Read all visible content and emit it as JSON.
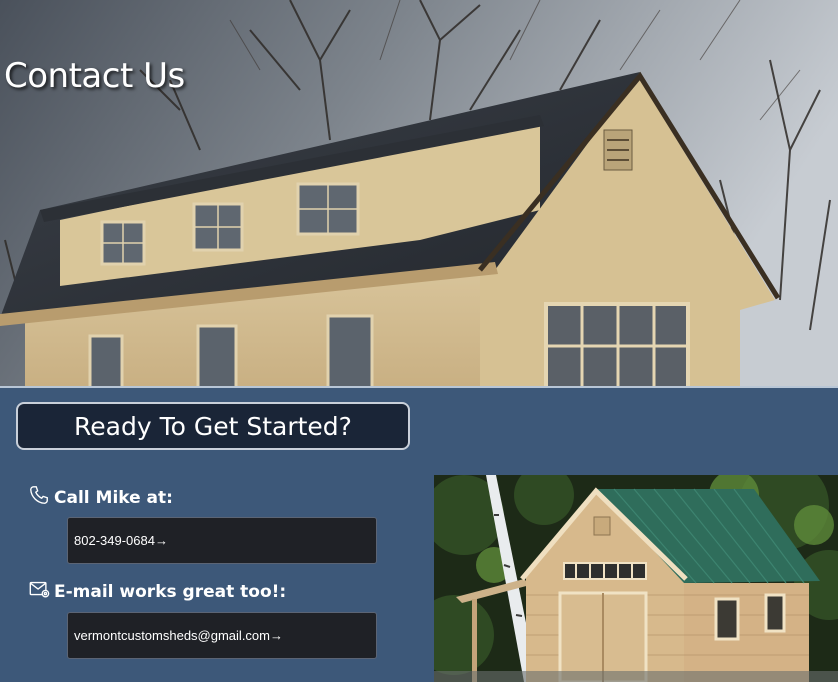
{
  "hero": {
    "title": "Contact Us",
    "image_alt": "two-story-barn-shed-photo"
  },
  "contact": {
    "cta_label": "Ready To Get Started?",
    "phone_label": "Call Mike at:",
    "phone_value": "802-349-0684→",
    "email_label": "E-mail works great too!:",
    "email_value": "vermontcustomsheds@gmail.com→",
    "photo_alt": "green-roof-shed-photo"
  },
  "colors": {
    "section_bg": "#3d5879",
    "cta_bg": "#1a2537",
    "button_bg": "#1f2126"
  }
}
